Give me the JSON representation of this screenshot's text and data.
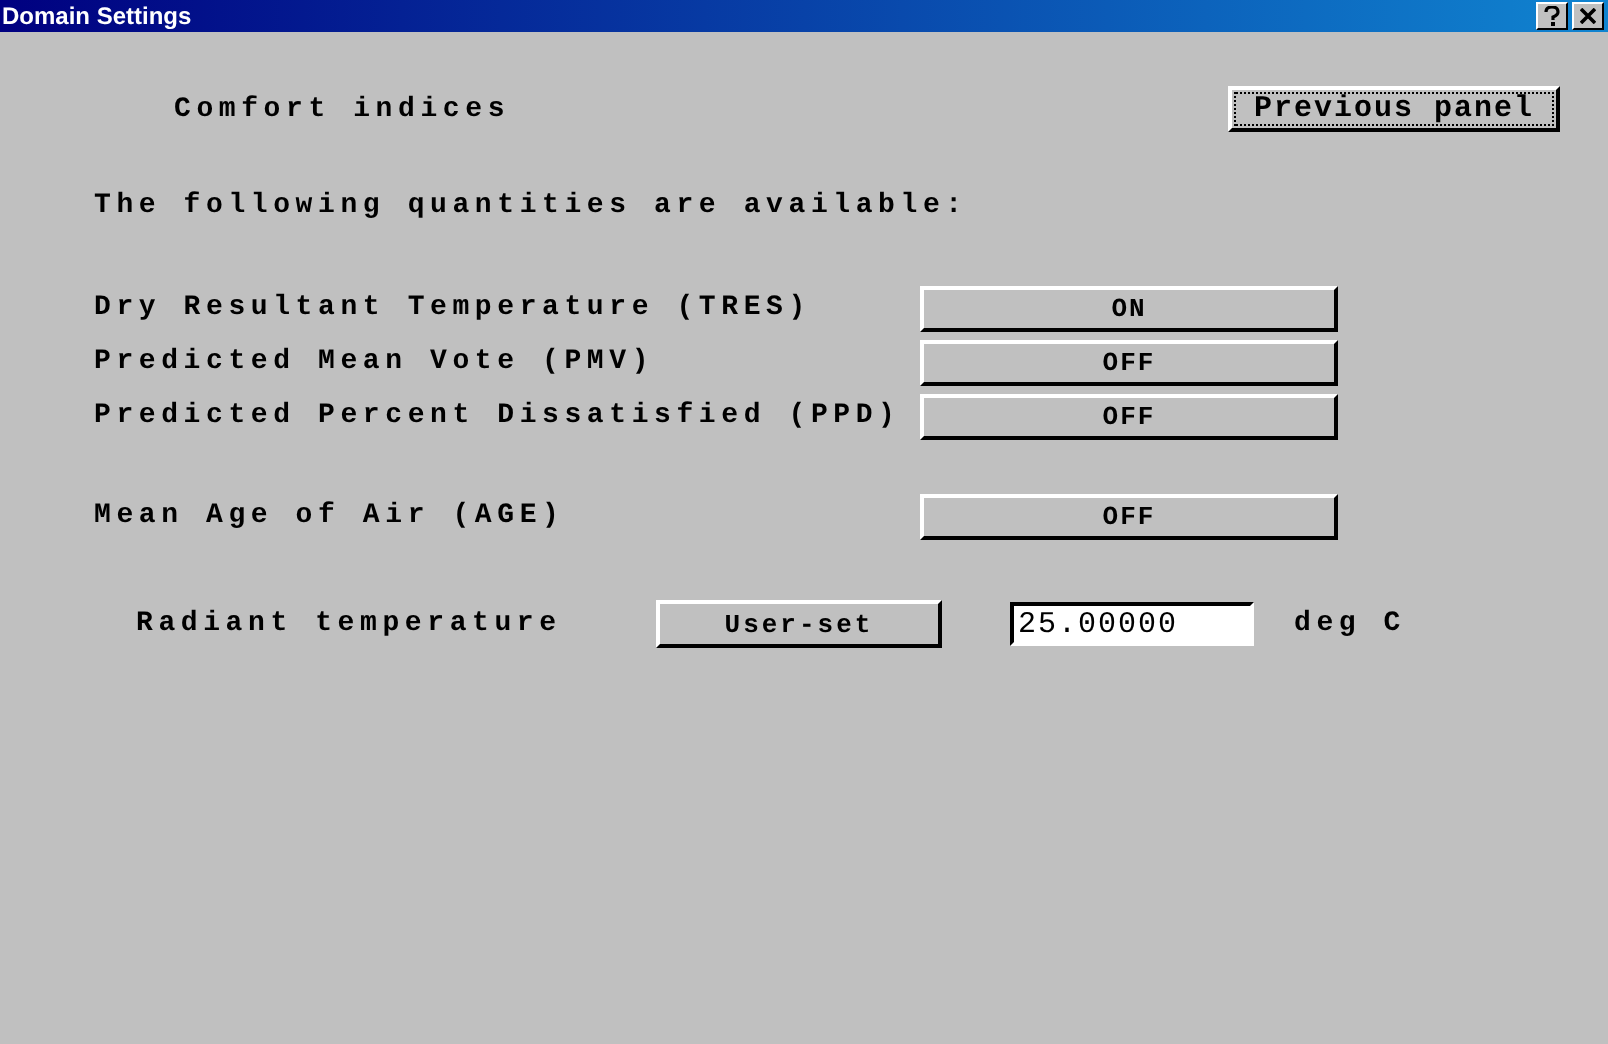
{
  "window": {
    "title": "Domain Settings"
  },
  "heading": "Comfort indices",
  "previous_button": "Previous panel",
  "intro": "The following quantities are available:",
  "quantities": [
    {
      "label": "Dry Resultant Temperature (TRES)",
      "value": "ON"
    },
    {
      "label": "Predicted Mean Vote (PMV)",
      "value": "OFF"
    },
    {
      "label": "Predicted Percent Dissatisfied (PPD)",
      "value": "OFF"
    }
  ],
  "age": {
    "label": "Mean Age of Air (AGE)",
    "value": "OFF"
  },
  "radiant": {
    "label": "Radiant temperature",
    "mode": "User-set",
    "value": "25.00000",
    "unit": "deg C"
  }
}
